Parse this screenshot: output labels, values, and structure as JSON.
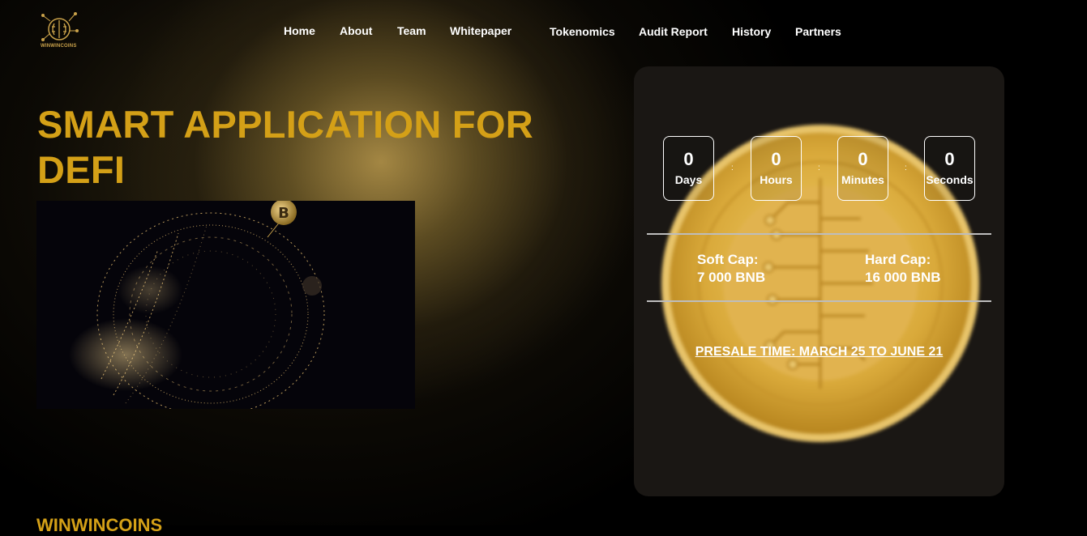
{
  "brand": {
    "name": "WINWINCOINS"
  },
  "nav": {
    "home": "Home",
    "about": "About",
    "team": "Team",
    "whitepaper": "Whitepaper",
    "tokenomics": "Tokenomics",
    "audit": "Audit Report",
    "history": "History",
    "partners": "Partners"
  },
  "hero": {
    "title": "SMART APPLICATION FOR DEFI",
    "bottom_title": "WINWINCOINS"
  },
  "countdown": {
    "days": {
      "value": "0",
      "label": "Days"
    },
    "hours": {
      "value": "0",
      "label": "Hours"
    },
    "minutes": {
      "value": "0",
      "label": "Minutes"
    },
    "seconds": {
      "value": "0",
      "label": "Seconds"
    },
    "separator": ":"
  },
  "caps": {
    "soft_label": "Soft Cap:",
    "soft_value": "7 000 BNB",
    "hard_label": "Hard Cap:",
    "hard_value": "16 000 BNB"
  },
  "presale": {
    "text": "PRESALE TIME: MARCH 25 TO JUNE 21"
  },
  "colors": {
    "accent": "#d4a017",
    "background": "#000000",
    "card": "#1a1714"
  },
  "icons": {
    "logo": "brain-circuit-logo",
    "hero": "crypto-globe-image",
    "coin": "circuit-coin-image"
  }
}
